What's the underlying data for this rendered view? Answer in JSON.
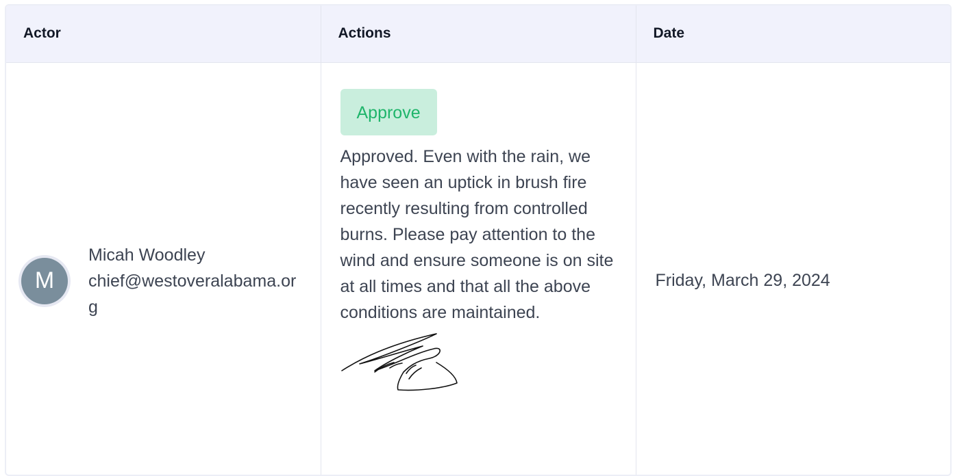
{
  "table": {
    "headers": {
      "actor": "Actor",
      "actions": "Actions",
      "date": "Date"
    },
    "rows": [
      {
        "actor": {
          "initial": "M",
          "name": "Micah Woodley",
          "email": "chief@westoveralabama.org"
        },
        "action": {
          "status": "Approve",
          "comment": "Approved. Even with the rain, we have seen an uptick in brush fire recently resulting from controlled burns. Please pay attention to the wind and ensure someone is on site at all times and that all the above conditions are maintained.",
          "signature": "signature-image"
        },
        "date": "Friday, March 29, 2024"
      }
    ]
  },
  "colors": {
    "header_bg": "#f1f2fc",
    "badge_bg": "#c9eedd",
    "badge_text": "#1fb56b",
    "avatar_bg": "#7a8e9c"
  }
}
